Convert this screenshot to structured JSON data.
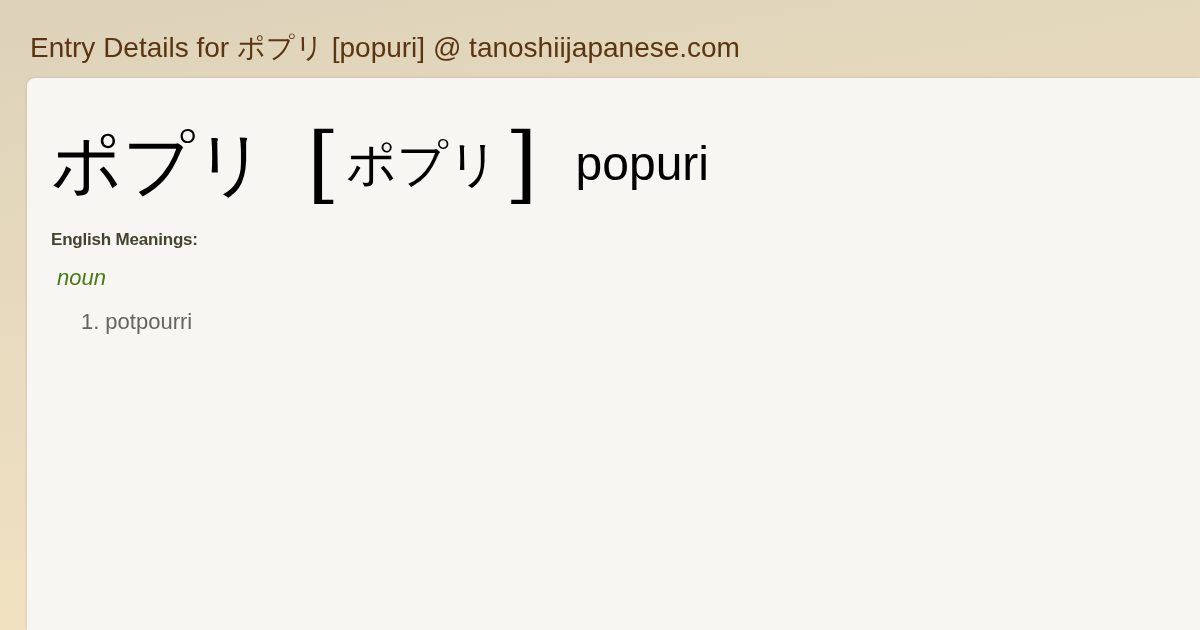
{
  "page_title": "Entry Details for ポプリ [popuri] @ tanoshiijapanese.com",
  "entry": {
    "headword": "ポプリ",
    "reading": {
      "open": "[",
      "text": "ポプリ",
      "close": "]"
    },
    "romaji": "popuri"
  },
  "meanings": {
    "heading": "English Meanings:",
    "groups": [
      {
        "part_of_speech": "noun",
        "senses": [
          {
            "number": "1.",
            "text": "potpourri"
          }
        ]
      }
    ]
  }
}
